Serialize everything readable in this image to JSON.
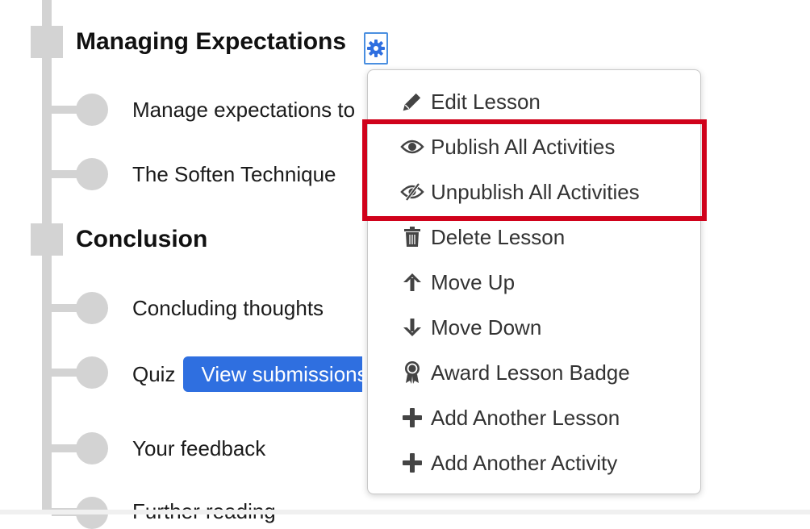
{
  "outline": {
    "section1": {
      "title": "Managing Expectations"
    },
    "section1_items": [
      {
        "label": "Manage expectations to"
      },
      {
        "label": "The Soften Technique"
      }
    ],
    "section2": {
      "title": "Conclusion"
    },
    "section2_items": [
      {
        "label": "Concluding thoughts"
      },
      {
        "label": "Quiz",
        "button": "View submissions"
      },
      {
        "label": "Your feedback"
      },
      {
        "label": "Further reading"
      }
    ]
  },
  "menu": {
    "items": [
      {
        "label": "Edit Lesson",
        "icon": "pencil-icon"
      },
      {
        "label": "Publish All Activities",
        "icon": "eye-icon"
      },
      {
        "label": "Unpublish All Activities",
        "icon": "eye-slash-icon"
      },
      {
        "label": "Delete Lesson",
        "icon": "trash-icon"
      },
      {
        "label": "Move Up",
        "icon": "arrow-up-icon"
      },
      {
        "label": "Move Down",
        "icon": "arrow-down-icon"
      },
      {
        "label": "Award Lesson Badge",
        "icon": "award-icon"
      },
      {
        "label": "Add Another Lesson",
        "icon": "plus-icon"
      },
      {
        "label": "Add Another Activity",
        "icon": "plus-icon"
      }
    ]
  },
  "colors": {
    "accent": "#2f6fe0",
    "highlight": "#d0021b",
    "timeline": "#d3d3d3"
  }
}
